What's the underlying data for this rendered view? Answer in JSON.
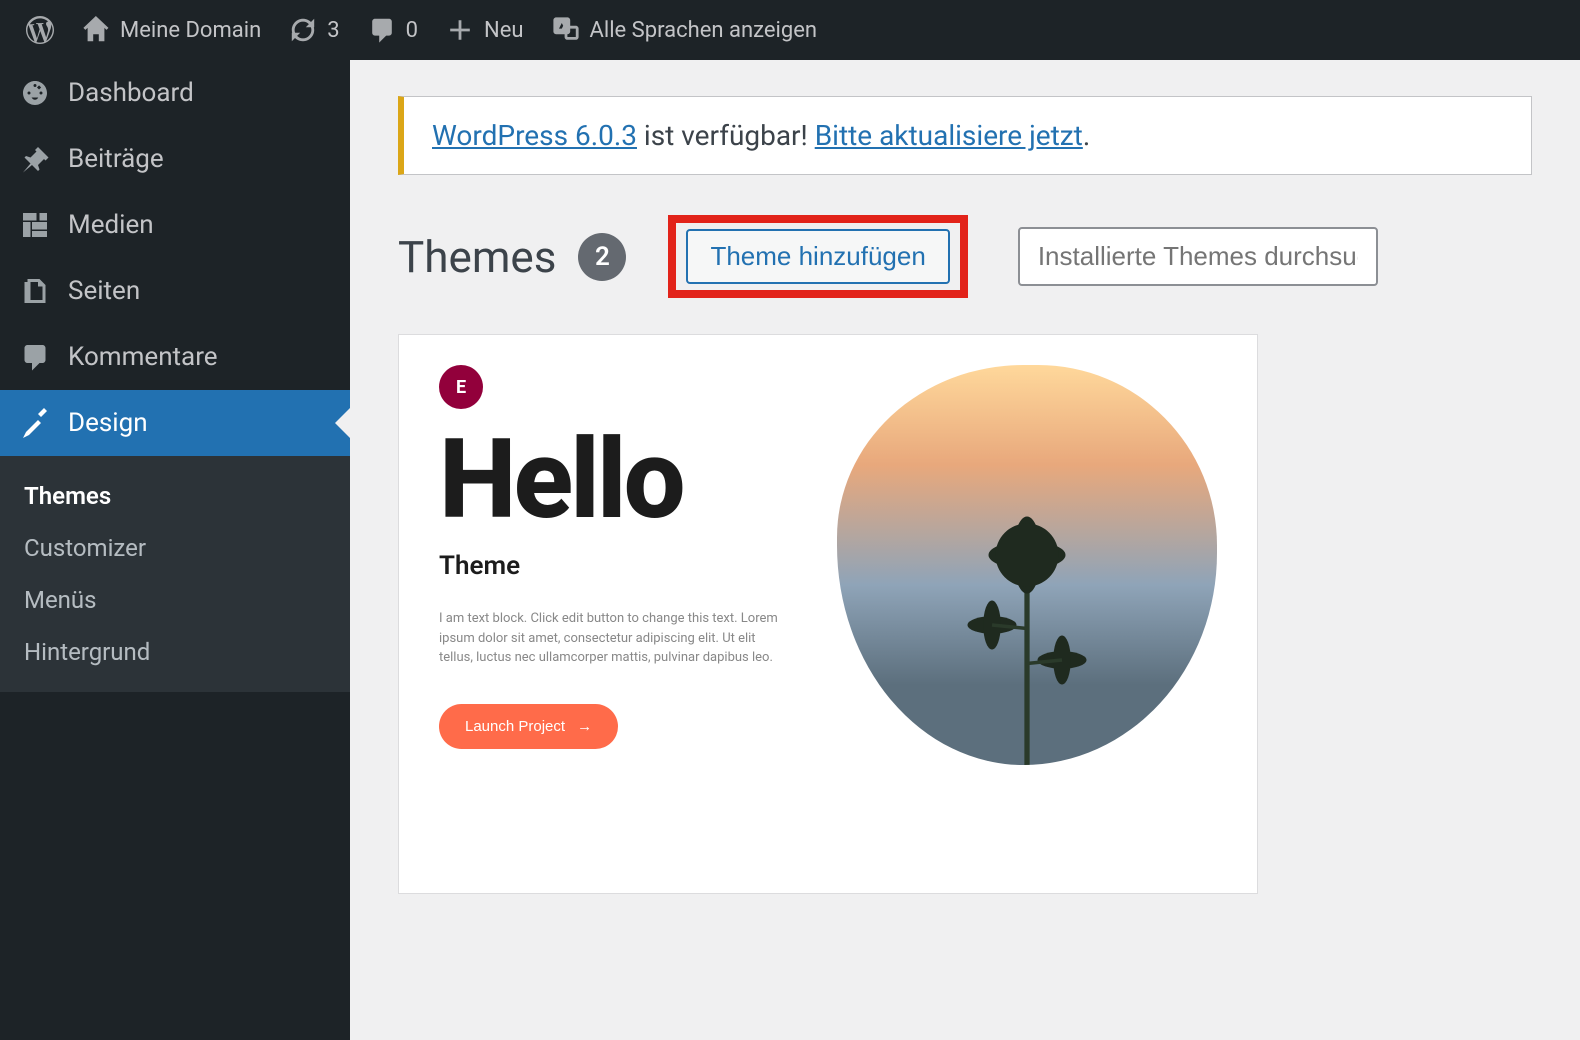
{
  "adminBar": {
    "siteName": "Meine Domain",
    "updateCount": "3",
    "commentCount": "0",
    "newLabel": "Neu",
    "languagesLabel": "Alle Sprachen anzeigen"
  },
  "sidebar": {
    "items": [
      {
        "label": "Dashboard"
      },
      {
        "label": "Beiträge"
      },
      {
        "label": "Medien"
      },
      {
        "label": "Seiten"
      },
      {
        "label": "Kommentare"
      },
      {
        "label": "Design"
      }
    ],
    "subItems": [
      {
        "label": "Themes",
        "current": true
      },
      {
        "label": "Customizer"
      },
      {
        "label": "Menüs"
      },
      {
        "label": "Hintergrund"
      }
    ]
  },
  "notice": {
    "linkVersion": "WordPress 6.0.3",
    "midText": " ist verfügbar! ",
    "linkAction": "Bitte aktualisiere jetzt",
    "trail": "."
  },
  "header": {
    "title": "Themes",
    "count": "2",
    "addButton": "Theme hinzufügen",
    "searchPlaceholder": "Installierte Themes durchsuchen"
  },
  "themePreview": {
    "heroTitle": "Hello",
    "heroSub": "Theme",
    "desc": "I am text block. Click edit button to change this text. Lorem ipsum dolor sit amet, consectetur adipiscing elit. Ut elit tellus, luctus nec ullamcorper mattis, pulvinar dapibus leo.",
    "buttonLabel": "Launch Project"
  }
}
